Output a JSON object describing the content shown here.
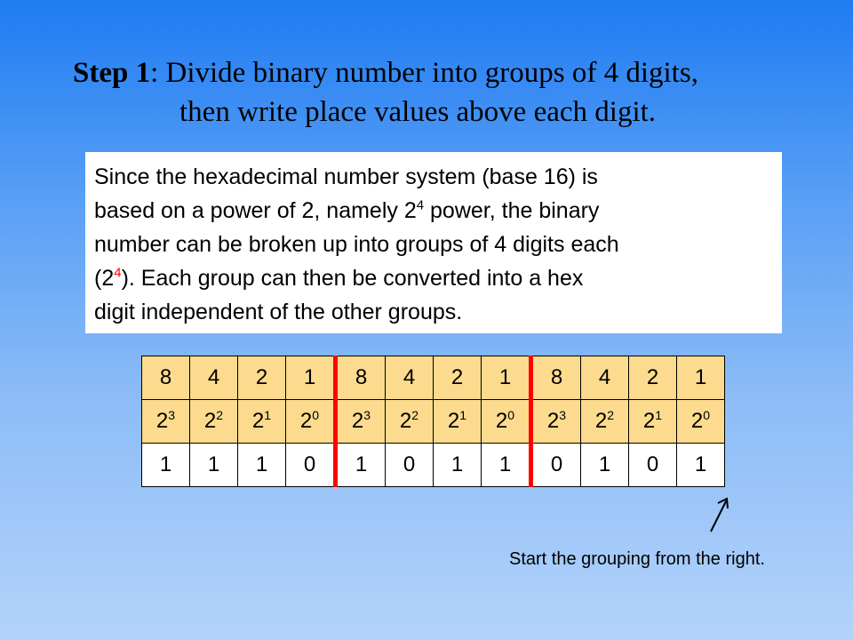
{
  "title": {
    "step_label": "Step 1",
    "line1_rest": ": Divide binary number into groups of 4 digits,",
    "line2": "then write place values above each digit."
  },
  "info": {
    "line1": "Since the hexadecimal  number system (base 16) is",
    "line2_pre": "based on a power of  2, namely 2",
    "line2_sup": "4",
    "line2_post": " power, the binary",
    "line3": "number can be broken up into groups of 4 digits each",
    "line4_pre": "(2",
    "line4_sup": "4",
    "line4_post": "). Each group can then be converted into a hex",
    "line5": "digit independent  of the other groups."
  },
  "table": {
    "place_values": [
      "8",
      "4",
      "2",
      "1",
      "8",
      "4",
      "2",
      "1",
      "8",
      "4",
      "2",
      "1"
    ],
    "powers_base": [
      "2",
      "2",
      "2",
      "2",
      "2",
      "2",
      "2",
      "2",
      "2",
      "2",
      "2",
      "2"
    ],
    "powers_exp": [
      "3",
      "2",
      "1",
      "0",
      "3",
      "2",
      "1",
      "0",
      "3",
      "2",
      "1",
      "0"
    ],
    "binary_digits": [
      "1",
      "1",
      "1",
      "0",
      "1",
      "0",
      "1",
      "1",
      "0",
      "1",
      "0",
      "1"
    ],
    "group_separator_color": "#ff0000",
    "header_fill_color": "#fcdb8e"
  },
  "caption": "Start the grouping from the right."
}
